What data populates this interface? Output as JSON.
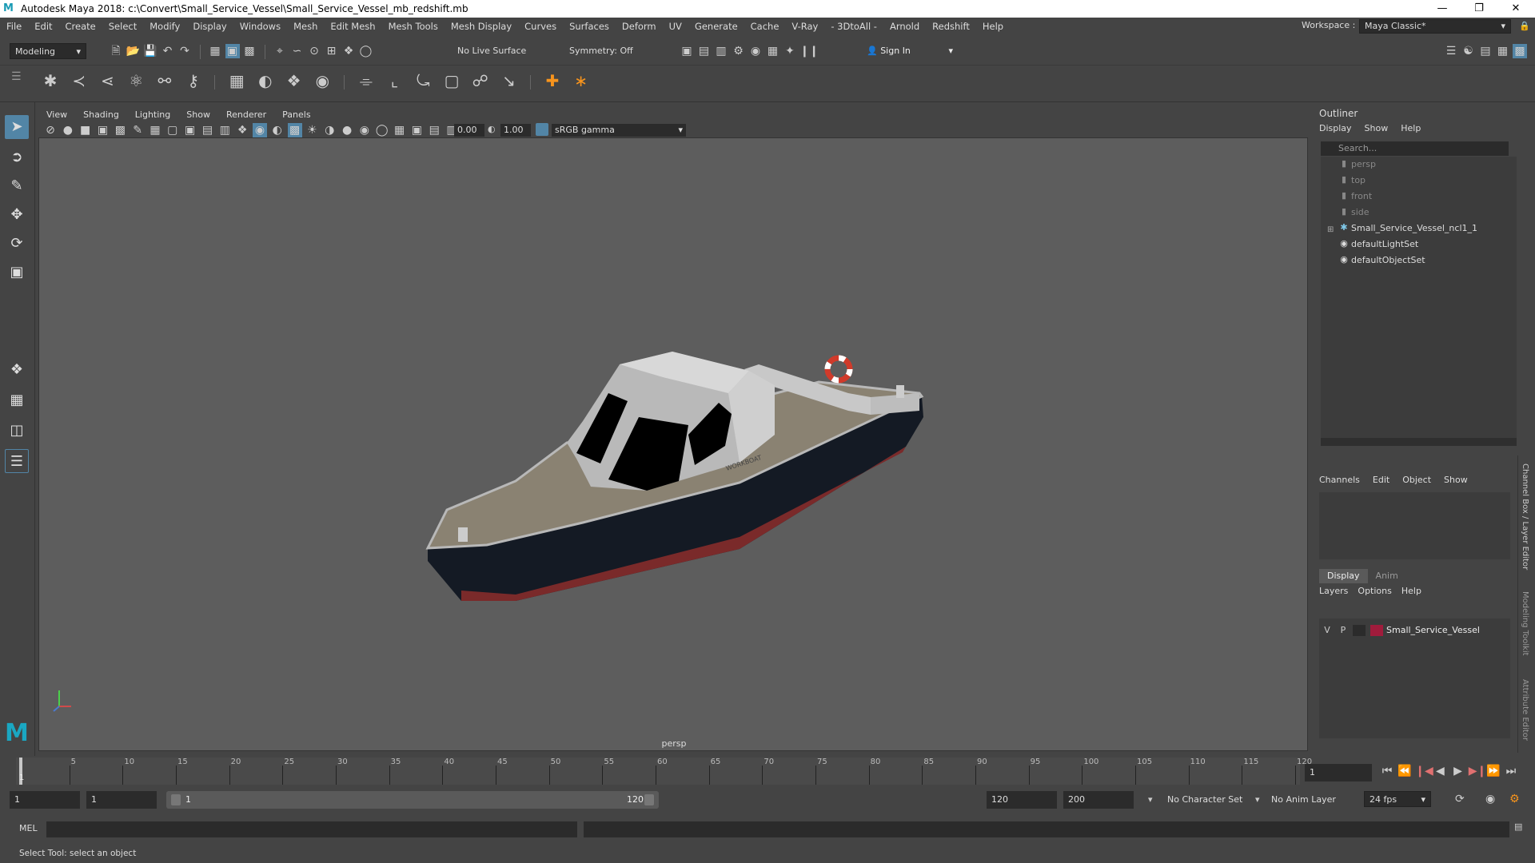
{
  "title_bar": {
    "app_title": "Autodesk Maya 2018: c:\\Convert\\Small_Service_Vessel\\Small_Service_Vessel_mb_redshift.mb",
    "logo": "M"
  },
  "menu": [
    "File",
    "Edit",
    "Create",
    "Select",
    "Modify",
    "Display",
    "Windows",
    "Mesh",
    "Edit Mesh",
    "Mesh Tools",
    "Mesh Display",
    "Curves",
    "Surfaces",
    "Deform",
    "UV",
    "Generate",
    "Cache",
    "V-Ray",
    "- 3DtoAll -",
    "Arnold",
    "Redshift",
    "Help"
  ],
  "workspace": {
    "label": "Workspace :",
    "value": "Maya Classic*"
  },
  "status_line": {
    "mode": "Modeling",
    "live_surface": "No Live Surface",
    "symmetry": "Symmetry: Off",
    "sign_in": "Sign In"
  },
  "viewport": {
    "menus": [
      "View",
      "Shading",
      "Lighting",
      "Show",
      "Renderer",
      "Panels"
    ],
    "exposure": "0.00",
    "gamma": "1.00",
    "color_space": "sRGB gamma",
    "camera_label": "persp",
    "boat_label": "WORKBOAT"
  },
  "outliner": {
    "title": "Outliner",
    "menus": [
      "Display",
      "Show",
      "Help"
    ],
    "search_placeholder": "Search...",
    "items": [
      {
        "label": "persp",
        "icon": "camera-icon",
        "dim": true
      },
      {
        "label": "top",
        "icon": "camera-icon",
        "dim": true
      },
      {
        "label": "front",
        "icon": "camera-icon",
        "dim": true
      },
      {
        "label": "side",
        "icon": "camera-icon",
        "dim": true
      },
      {
        "label": "Small_Service_Vessel_ncl1_1",
        "icon": "transform-icon",
        "dim": false,
        "expandable": true
      },
      {
        "label": "defaultLightSet",
        "icon": "set-icon",
        "dim": false
      },
      {
        "label": "defaultObjectSet",
        "icon": "set-icon",
        "dim": false
      }
    ]
  },
  "channel_box": {
    "menus": [
      "Channels",
      "Edit",
      "Object",
      "Show"
    ]
  },
  "layer_editor": {
    "tabs": [
      "Display",
      "Anim"
    ],
    "menus": [
      "Layers",
      "Options",
      "Help"
    ],
    "layer": {
      "v": "V",
      "p": "P",
      "name": "Small_Service_Vessel",
      "color": "#a01c3c"
    }
  },
  "side_tabs": [
    "Channel Box / Layer Editor",
    "Modeling Toolkit",
    "Attribute Editor"
  ],
  "timeline": {
    "ticks": [
      "5",
      "10",
      "15",
      "20",
      "25",
      "30",
      "35",
      "40",
      "45",
      "50",
      "55",
      "60",
      "65",
      "70",
      "75",
      "80",
      "85",
      "90",
      "95",
      "100",
      "105",
      "110",
      "115",
      "120"
    ],
    "current_frame_marker": "1",
    "current_frame": "1"
  },
  "range_slider": {
    "start": "1",
    "anim_start": "1",
    "slider_start": "1",
    "slider_end": "120",
    "end": "120",
    "anim_end": "200",
    "character_set": "No Character Set",
    "anim_layer": "No Anim Layer",
    "fps": "24 fps"
  },
  "command_line": {
    "label": "MEL"
  },
  "help_line": "Select Tool: select an object",
  "colors": {
    "accent": "#5285a6",
    "viewport_bg": "#5d5d5d",
    "panel": "#444444"
  }
}
